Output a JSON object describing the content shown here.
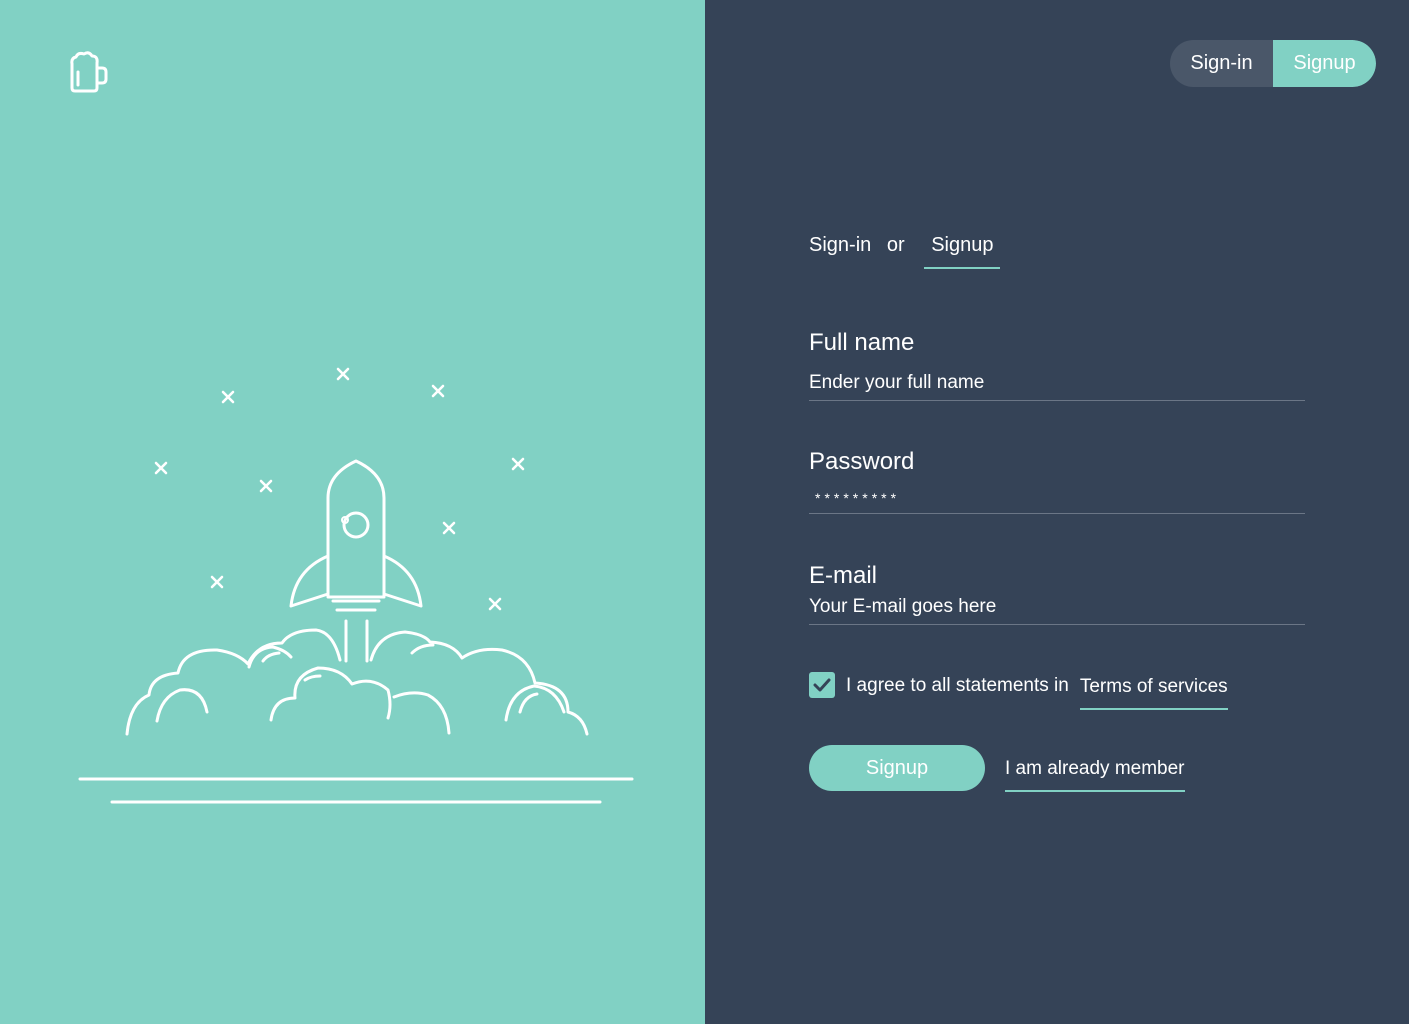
{
  "brand": {
    "logo_icon": "mug-icon",
    "accent_color": "#81d1c4",
    "panel_color": "#354357"
  },
  "illustration": {
    "icon": "rocket-launch-illustration"
  },
  "header_toggle": {
    "signin_label": "Sign-in",
    "signup_label": "Signup",
    "active": "Signup"
  },
  "form_switch": {
    "signin_label": "Sign-in",
    "or_label": "or",
    "signup_label": "Signup"
  },
  "fields": {
    "full_name": {
      "label": "Full name",
      "placeholder": "Ender your full name"
    },
    "password": {
      "label": "Password",
      "value": "*********"
    },
    "email": {
      "label": "E-mail",
      "placeholder": "Your E-mail goes here"
    }
  },
  "agreement": {
    "checked": true,
    "text": "I agree to all statements in",
    "link": "Terms of services"
  },
  "actions": {
    "submit_label": "Signup",
    "member_link": "I am already member"
  }
}
